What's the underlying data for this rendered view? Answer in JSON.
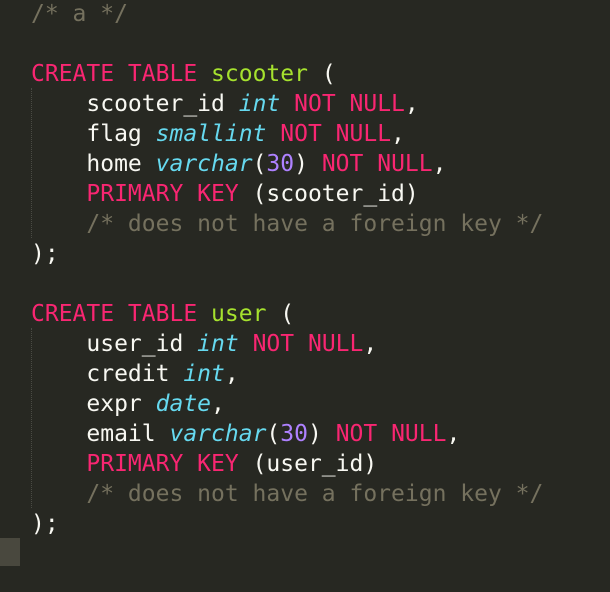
{
  "editor": {
    "theme_colors": {
      "background": "#272822",
      "keyword": "#f92672",
      "type": "#66d9ef",
      "table_name": "#a6e22e",
      "number": "#ae81ff",
      "comment": "#75715e",
      "text": "#f8f8f2"
    },
    "lines": [
      [
        {
          "t": "/* a */",
          "c": "cm"
        }
      ],
      [],
      [
        {
          "t": "CREATE TABLE",
          "c": "kw"
        },
        {
          "t": " ",
          "c": "plain"
        },
        {
          "t": "scooter",
          "c": "tbl"
        },
        {
          "t": " (",
          "c": "plain"
        }
      ],
      [
        {
          "t": "    scooter_id ",
          "c": "plain"
        },
        {
          "t": "int",
          "c": "type"
        },
        {
          "t": " ",
          "c": "plain"
        },
        {
          "t": "NOT NULL",
          "c": "kw"
        },
        {
          "t": ",",
          "c": "plain"
        }
      ],
      [
        {
          "t": "    flag ",
          "c": "plain"
        },
        {
          "t": "smallint",
          "c": "type"
        },
        {
          "t": " ",
          "c": "plain"
        },
        {
          "t": "NOT NULL",
          "c": "kw"
        },
        {
          "t": ",",
          "c": "plain"
        }
      ],
      [
        {
          "t": "    home ",
          "c": "plain"
        },
        {
          "t": "varchar",
          "c": "type"
        },
        {
          "t": "(",
          "c": "plain"
        },
        {
          "t": "30",
          "c": "num"
        },
        {
          "t": ") ",
          "c": "plain"
        },
        {
          "t": "NOT NULL",
          "c": "kw"
        },
        {
          "t": ",",
          "c": "plain"
        }
      ],
      [
        {
          "t": "    ",
          "c": "plain"
        },
        {
          "t": "PRIMARY KEY",
          "c": "kw"
        },
        {
          "t": " (scooter_id)",
          "c": "plain"
        }
      ],
      [
        {
          "t": "    /* does not have a foreign key */",
          "c": "cm"
        }
      ],
      [
        {
          "t": ");",
          "c": "plain"
        }
      ],
      [],
      [
        {
          "t": "CREATE TABLE",
          "c": "kw"
        },
        {
          "t": " ",
          "c": "plain"
        },
        {
          "t": "user",
          "c": "tbl"
        },
        {
          "t": " (",
          "c": "plain"
        }
      ],
      [
        {
          "t": "    user_id ",
          "c": "plain"
        },
        {
          "t": "int",
          "c": "type"
        },
        {
          "t": " ",
          "c": "plain"
        },
        {
          "t": "NOT NULL",
          "c": "kw"
        },
        {
          "t": ",",
          "c": "plain"
        }
      ],
      [
        {
          "t": "    credit ",
          "c": "plain"
        },
        {
          "t": "int",
          "c": "type"
        },
        {
          "t": ",",
          "c": "plain"
        }
      ],
      [
        {
          "t": "    expr ",
          "c": "plain"
        },
        {
          "t": "date",
          "c": "type"
        },
        {
          "t": ",",
          "c": "plain"
        }
      ],
      [
        {
          "t": "    email ",
          "c": "plain"
        },
        {
          "t": "varchar",
          "c": "type"
        },
        {
          "t": "(",
          "c": "plain"
        },
        {
          "t": "30",
          "c": "num"
        },
        {
          "t": ") ",
          "c": "plain"
        },
        {
          "t": "NOT NULL",
          "c": "kw"
        },
        {
          "t": ",",
          "c": "plain"
        }
      ],
      [
        {
          "t": "    ",
          "c": "plain"
        },
        {
          "t": "PRIMARY KEY",
          "c": "kw"
        },
        {
          "t": " (user_id)",
          "c": "plain"
        }
      ],
      [
        {
          "t": "    /* does not have a foreign key */",
          "c": "cm"
        }
      ],
      [
        {
          "t": ");",
          "c": "plain"
        }
      ]
    ]
  }
}
